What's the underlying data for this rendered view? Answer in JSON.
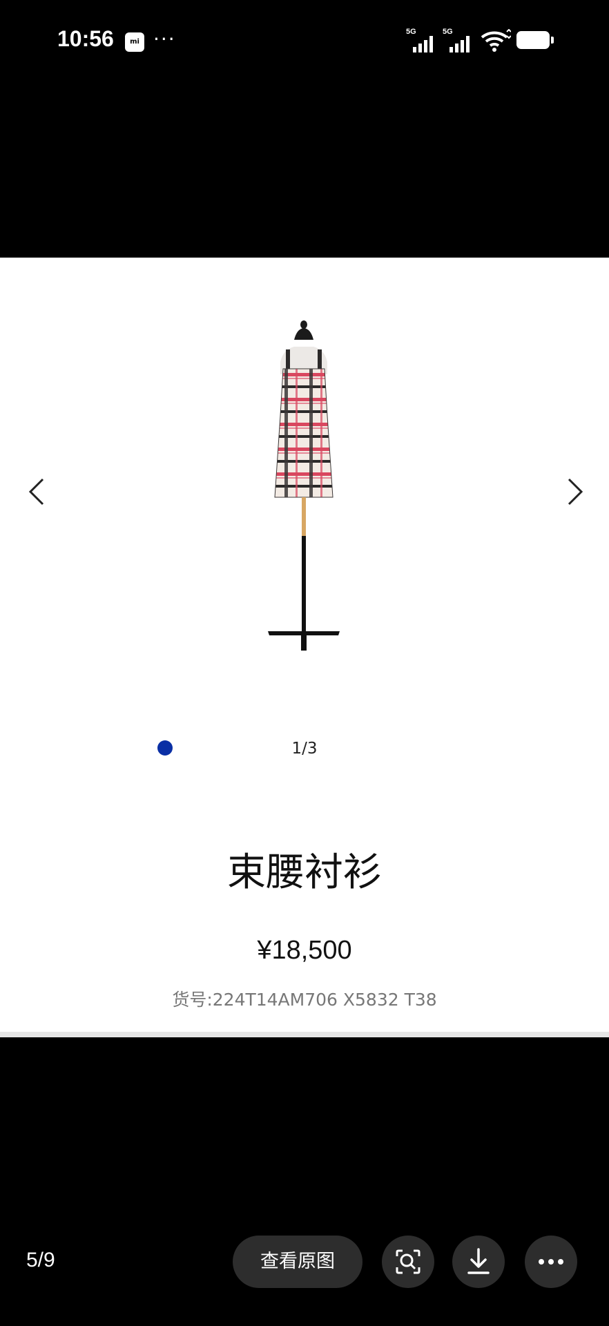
{
  "status_bar": {
    "time": "10:56",
    "mi_badge": "mi",
    "more": "···",
    "signal1": "5G",
    "signal2": "5G"
  },
  "product": {
    "pager": "1/3",
    "title": "束腰衬衫",
    "price": "¥18,500",
    "sku": "货号:224T14AM706 X5832 T38"
  },
  "viewer": {
    "counter": "5/9",
    "view_original": "查看原图"
  },
  "colors": {
    "dot": "#0a2fa5",
    "button_bg": "#2d2d2d"
  },
  "icons": [
    "chevron-left-icon",
    "chevron-right-icon",
    "image-search-icon",
    "download-icon",
    "more-icon",
    "wifi-icon",
    "battery-icon",
    "signal-icon"
  ]
}
